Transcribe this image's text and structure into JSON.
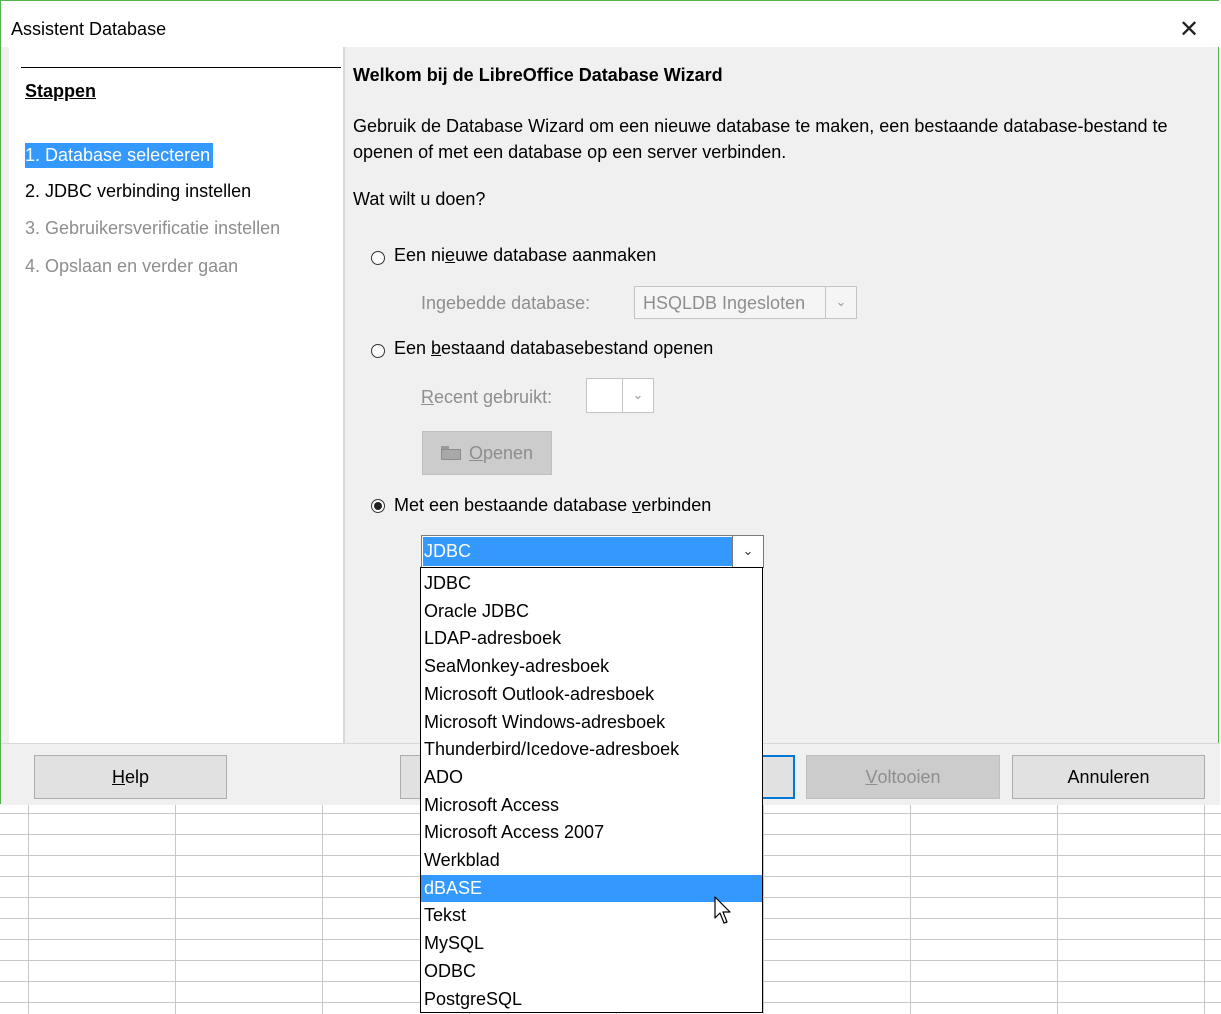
{
  "window": {
    "title": "Assistent Database",
    "close_glyph": "✕"
  },
  "steps": {
    "title": "Stappen",
    "items": [
      {
        "label": "1. Database selecteren",
        "state": "active"
      },
      {
        "label": "2. JDBC verbinding instellen",
        "state": "enabled"
      },
      {
        "label": "3. Gebruikersverificatie instellen",
        "state": "disabled"
      },
      {
        "label": "4. Opslaan en verder gaan",
        "state": "disabled"
      }
    ]
  },
  "main": {
    "heading": "Welkom bij de LibreOffice Database Wizard",
    "intro": "Gebruik de Database Wizard om een nieuwe database te maken, een bestaande database-bestand te openen of met een database op een server verbinden.",
    "question": "Wat wilt u doen?",
    "option_new": {
      "label_pre": "Een ni",
      "label_key": "e",
      "label_post": "uwe database aanmaken",
      "checked": false,
      "embedded_label": "Ingebedde database:",
      "embedded_value": "HSQLDB Ingesloten"
    },
    "option_open": {
      "label_pre": "Een ",
      "label_key": "b",
      "label_post": "estaand databasebestand openen",
      "checked": false,
      "recent_label_key": "R",
      "recent_label_rest": "ecent gebruikt:",
      "open_button_key": "O",
      "open_button_rest": "penen"
    },
    "option_connect": {
      "label_pre": "Met een bestaande database ",
      "label_key": "v",
      "label_post": "erbinden",
      "checked": true,
      "selected_value": "JDBC"
    },
    "dropdown_options": [
      "JDBC",
      "Oracle JDBC",
      "LDAP-adresboek",
      "SeaMonkey-adresboek",
      "Microsoft Outlook-adresboek",
      "Microsoft Windows-adresboek",
      "Thunderbird/Icedove-adresboek",
      "ADO",
      "Microsoft Access",
      "Microsoft Access 2007",
      "Werkblad",
      "dBASE",
      "Tekst",
      "MySQL",
      "ODBC",
      "PostgreSQL"
    ],
    "highlighted_option": "dBASE"
  },
  "buttons": {
    "help_key": "H",
    "help_rest": "elp",
    "finish_key": "V",
    "finish_rest": "oltooien",
    "cancel": "Annuleren"
  },
  "colors": {
    "selection": "#3399ff",
    "disabled_text": "#8e8e8e",
    "window_border": "#55b24e"
  }
}
